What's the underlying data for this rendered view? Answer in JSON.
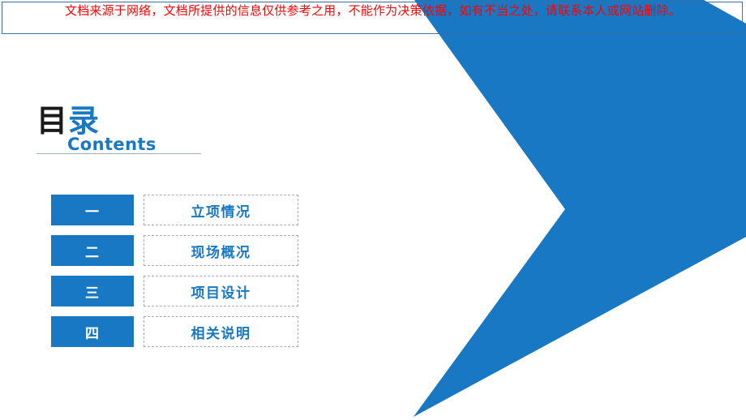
{
  "disclaimer": {
    "text": "文档来源于网络，文档所提供的信息仅供参考之用，不能作为决策依据，如有不当之处，请联系本人或网站删除。"
  },
  "heading": {
    "cn_dark": "目",
    "cn_blue": "录",
    "en": "Contents"
  },
  "contents": {
    "items": [
      {
        "num": "一",
        "label": "立项情况"
      },
      {
        "num": "二",
        "label": "现场概况"
      },
      {
        "num": "三",
        "label": "项目设计"
      },
      {
        "num": "四",
        "label": "相关说明"
      }
    ]
  },
  "decoration": {
    "chevron_name": "chevron-right-shape",
    "chevron_color": "#1878c4"
  },
  "colors": {
    "accent_blue": "#1878c4",
    "warning_red": "#ff0000",
    "banner_border": "#3b6ea5",
    "rule_gray": "#9bb0c4",
    "dashed_border": "#aaaaaa",
    "heading_dark": "#1a1a1a"
  }
}
